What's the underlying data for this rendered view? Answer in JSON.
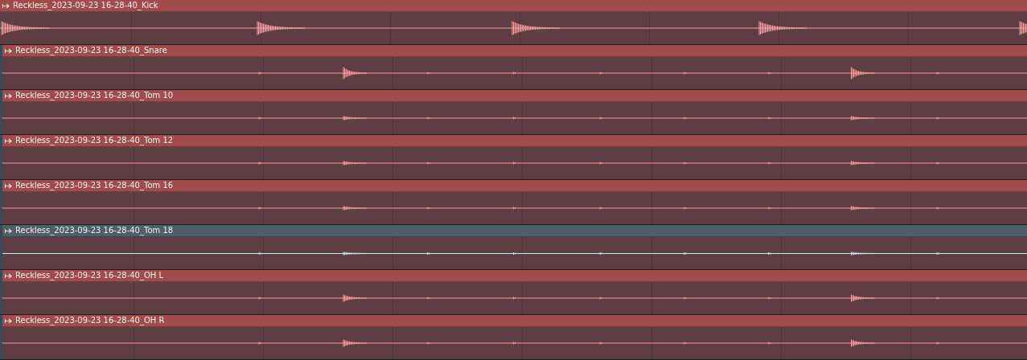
{
  "clips": [
    {
      "title": "Reckless_2023-09-23 16-28-40_Kick",
      "color": "#a04c4c"
    },
    {
      "title": "Reckless_2023-09-23 16-28-40_Snare",
      "color": "#a04c4c"
    },
    {
      "title": "Reckless_2023-09-23 16-28-40_Tom 10",
      "color": "#a04c4c"
    },
    {
      "title": "Reckless_2023-09-23 16-28-40_Tom 12",
      "color": "#a04c4c"
    },
    {
      "title": "Reckless_2023-09-23 16-28-40_Tom 16",
      "color": "#a04c4c"
    },
    {
      "title": "Reckless_2023-09-23 16-28-40_Tom 18",
      "color": "#4f5f6a"
    },
    {
      "title": "Reckless_2023-09-23 16-28-40_OH  L",
      "color": "#a04c4c"
    },
    {
      "title": "Reckless_2023-09-23 16-28-40_OH  R",
      "color": "#a04c4c"
    }
  ]
}
